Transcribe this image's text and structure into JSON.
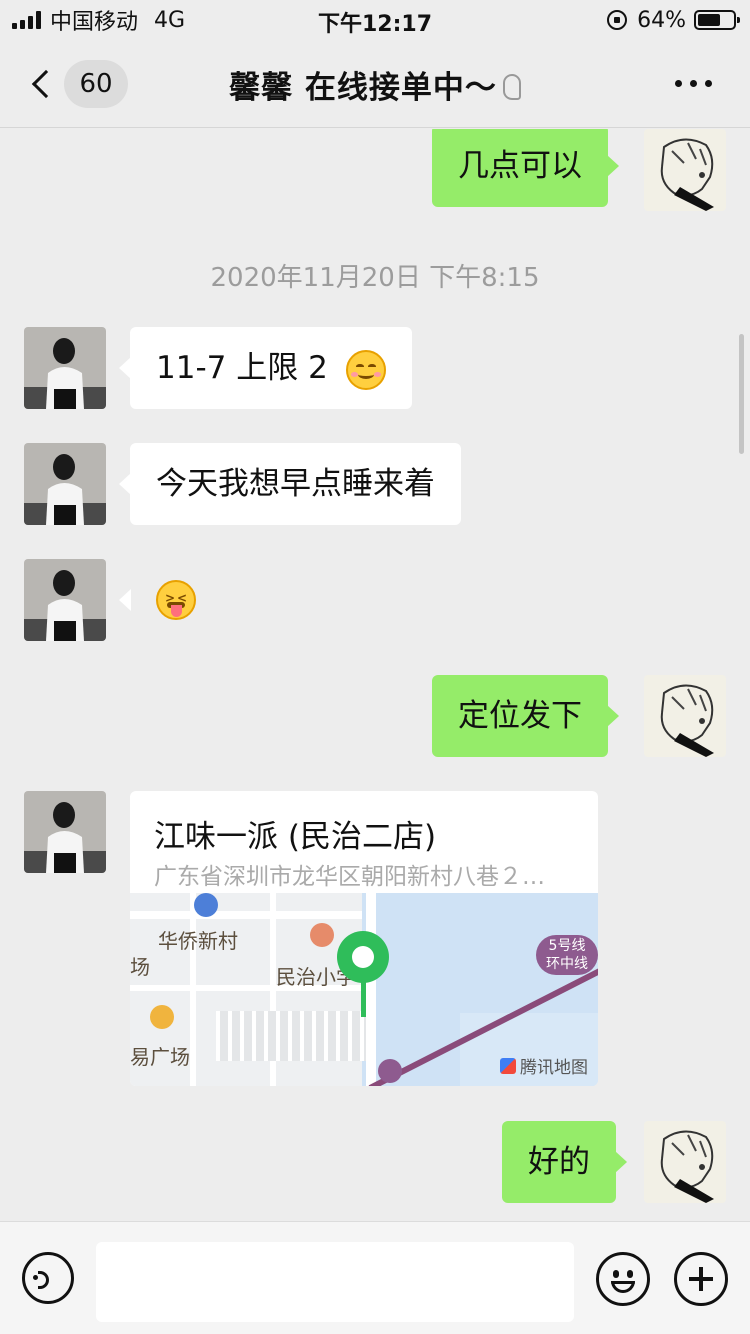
{
  "status_bar": {
    "carrier": "中国移动",
    "network": "4G",
    "time": "下午12:17",
    "battery_percent": "64%",
    "battery_level": 0.64
  },
  "nav": {
    "unread_count": "60",
    "title": "馨馨 在线接单中～"
  },
  "chat": {
    "messages": [
      {
        "side": "right",
        "text": "几点可以"
      },
      {
        "type": "timestamp",
        "text": "2020年11月20日 下午8:15"
      },
      {
        "side": "left",
        "text": "11-7 上限 2",
        "emoji": "smiling-face-icon"
      },
      {
        "side": "left",
        "text": "今天我想早点睡来着"
      },
      {
        "side": "left",
        "text": "",
        "emoji": "squinting-tongue-face-icon"
      },
      {
        "side": "right",
        "text": "定位发下"
      },
      {
        "side": "left",
        "type": "location",
        "title": "江味一派 (民治二店)",
        "address": "广东省深圳市龙华区朝阳新村八巷２…",
        "map": {
          "labels": [
            "华侨新村",
            "民治小学",
            "易广场",
            "场"
          ],
          "metro_badge": [
            "5号线",
            "环中线"
          ],
          "watermark": "腾讯地图"
        }
      },
      {
        "side": "right",
        "text": "好的"
      }
    ]
  },
  "input_bar": {
    "placeholder": ""
  },
  "colors": {
    "background": "#ededed",
    "outgoing_bubble": "#95ec69",
    "incoming_bubble": "#ffffff",
    "map_pin": "#2fbd5a",
    "metro_line": "#8e5b8f"
  }
}
